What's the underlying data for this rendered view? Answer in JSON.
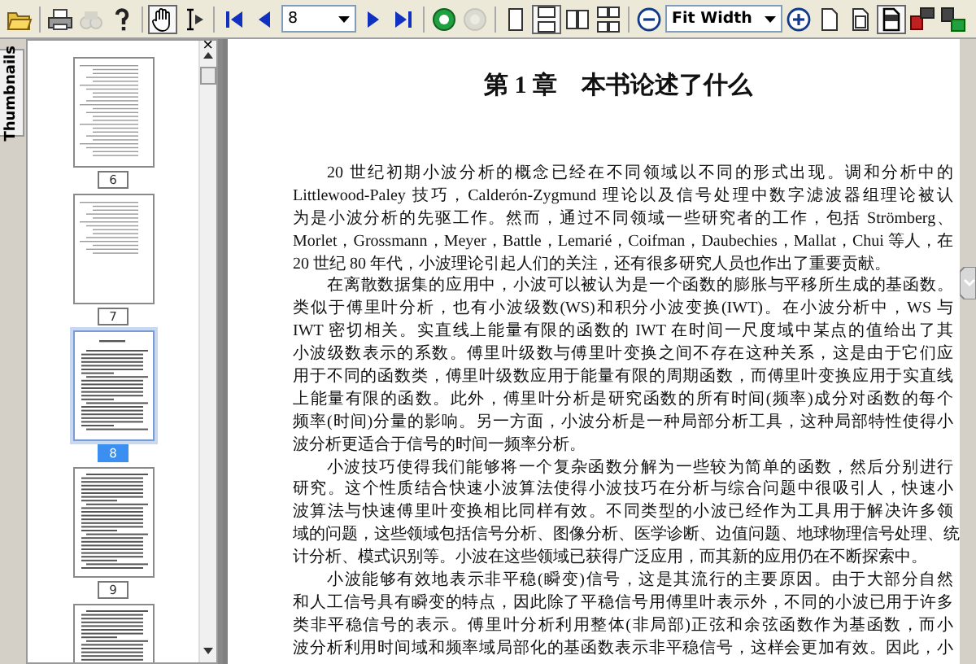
{
  "toolbar": {
    "groups": [
      [
        {
          "kind": "open",
          "pressed": false,
          "disabled": false
        }
      ],
      [
        {
          "kind": "print",
          "pressed": false,
          "disabled": false
        },
        {
          "kind": "find",
          "pressed": false,
          "disabled": true
        },
        {
          "kind": "help",
          "pressed": false,
          "disabled": false
        }
      ],
      [
        {
          "kind": "hand",
          "pressed": true,
          "disabled": false
        },
        {
          "kind": "select",
          "pressed": false,
          "disabled": false
        }
      ],
      [
        {
          "kind": "first",
          "pressed": false,
          "disabled": false
        },
        {
          "kind": "prev",
          "pressed": false,
          "disabled": false
        },
        {
          "kind": "page-field",
          "value": "8"
        },
        {
          "kind": "next",
          "pressed": false,
          "disabled": false
        },
        {
          "kind": "last",
          "pressed": false,
          "disabled": false
        }
      ],
      [
        {
          "kind": "back",
          "pressed": false,
          "disabled": false
        },
        {
          "kind": "forward",
          "pressed": false,
          "disabled": true
        }
      ],
      [
        {
          "kind": "single",
          "pressed": false,
          "disabled": false
        },
        {
          "kind": "continuous",
          "pressed": true,
          "disabled": false
        },
        {
          "kind": "facing",
          "pressed": false,
          "disabled": false
        },
        {
          "kind": "continuous-facing",
          "pressed": false,
          "disabled": false
        }
      ],
      [
        {
          "kind": "zoom-out",
          "pressed": false,
          "disabled": false
        },
        {
          "kind": "zoom-field",
          "value": "Fit Width"
        },
        {
          "kind": "zoom-in",
          "pressed": false,
          "disabled": false
        },
        {
          "kind": "actual-size",
          "pressed": false,
          "disabled": false
        },
        {
          "kind": "fit-page",
          "pressed": false,
          "disabled": false
        },
        {
          "kind": "fit-width",
          "pressed": true,
          "disabled": false
        },
        {
          "kind": "rotate-left",
          "pressed": false,
          "disabled": false
        },
        {
          "kind": "rotate-right",
          "pressed": false,
          "disabled": false
        }
      ]
    ]
  },
  "sidebar": {
    "tab": "Thumbnails",
    "close": "×",
    "thumbnails": [
      {
        "label": "6",
        "selected": false,
        "kind": "toc"
      },
      {
        "label": "7",
        "selected": false,
        "kind": "toc-short"
      },
      {
        "label": "8",
        "selected": true,
        "kind": "chapter"
      },
      {
        "label": "9",
        "selected": false,
        "kind": "text"
      },
      {
        "selected": false,
        "kind": "text"
      }
    ]
  },
  "document": {
    "title": "第 1 章　本书论述了什么",
    "paragraphs": [
      {
        "lines": [
          "20 世纪初期小波分析的概念已经在不同领域以不同的形式出现。调和分析中的",
          "Littlewood-Paley 技巧，Calderón-Zygmund 理论以及信号处理中数字滤波器组理论被认",
          "为是小波分析的先驱工作。然而，通过不同领域一些研究者的工作，包括 Strömberg、",
          "Morlet，Grossmann，Meyer，Battle，Lemarié，Coifman，Daubechies，Mallat，Chui 等人，在",
          "20 世纪 80 年代，小波理论引起人们的关注，还有很多研究人员也作出了重要贡献。"
        ]
      },
      {
        "lines": [
          "在离散数据集的应用中，小波可以被认为是一个函数的膨胀与平移所生成的基函数。",
          "类似于傅里叶分析，也有小波级数(WS)和积分小波变换(IWT)。在小波分析中，WS 与",
          "IWT 密切相关。实直线上能量有限的函数的 IWT 在时间一尺度域中某点的值给出了其",
          "小波级数表示的系数。傅里叶级数与傅里叶变换之间不存在这种关系，这是由于它们应",
          "用于不同的函数类，傅里叶级数应用于能量有限的周期函数，而傅里叶变换应用于实直线",
          "上能量有限的函数。此外，傅里叶分析是研究函数的所有时间(频率)成分对函数的每个",
          "频率(时间)分量的影响。另一方面，小波分析是一种局部分析工具，这种局部特性使得小",
          "波分析更适合于信号的时间一频率分析。"
        ]
      },
      {
        "lines": [
          "小波技巧使得我们能够将一个复杂函数分解为一些较为简单的函数，然后分别进行",
          "研究。这个性质结合快速小波算法使得小波技巧在分析与综合问题中很吸引人，快速小",
          "波算法与快速傅里叶变换相比同样有效。不同类型的小波已经作为工具用于解决许多领",
          "域的问题，这些领域包括信号分析、图像分析、医学诊断、边值问题、地球物理信号处理、统",
          "计分析、模式识别等。小波在这些领域已获得广泛应用，而其新的应用仍在不断探索中。"
        ]
      },
      {
        "lines": [
          "小波能够有效地表示非平稳(瞬变)信号，这是其流行的主要原因。由于大部分自然",
          "和人工信号具有瞬变的特点，因此除了平稳信号用傅里叶表示外，不同的小波已用于许多",
          "类非平稳信号的表示。傅里叶分析利用整体(非局部)正弦和余弦函数作为基函数，而小",
          "波分析利用时间域和频率域局部化的基函数表示非平稳信号，这样会更加有效。因此，小"
        ]
      }
    ]
  }
}
